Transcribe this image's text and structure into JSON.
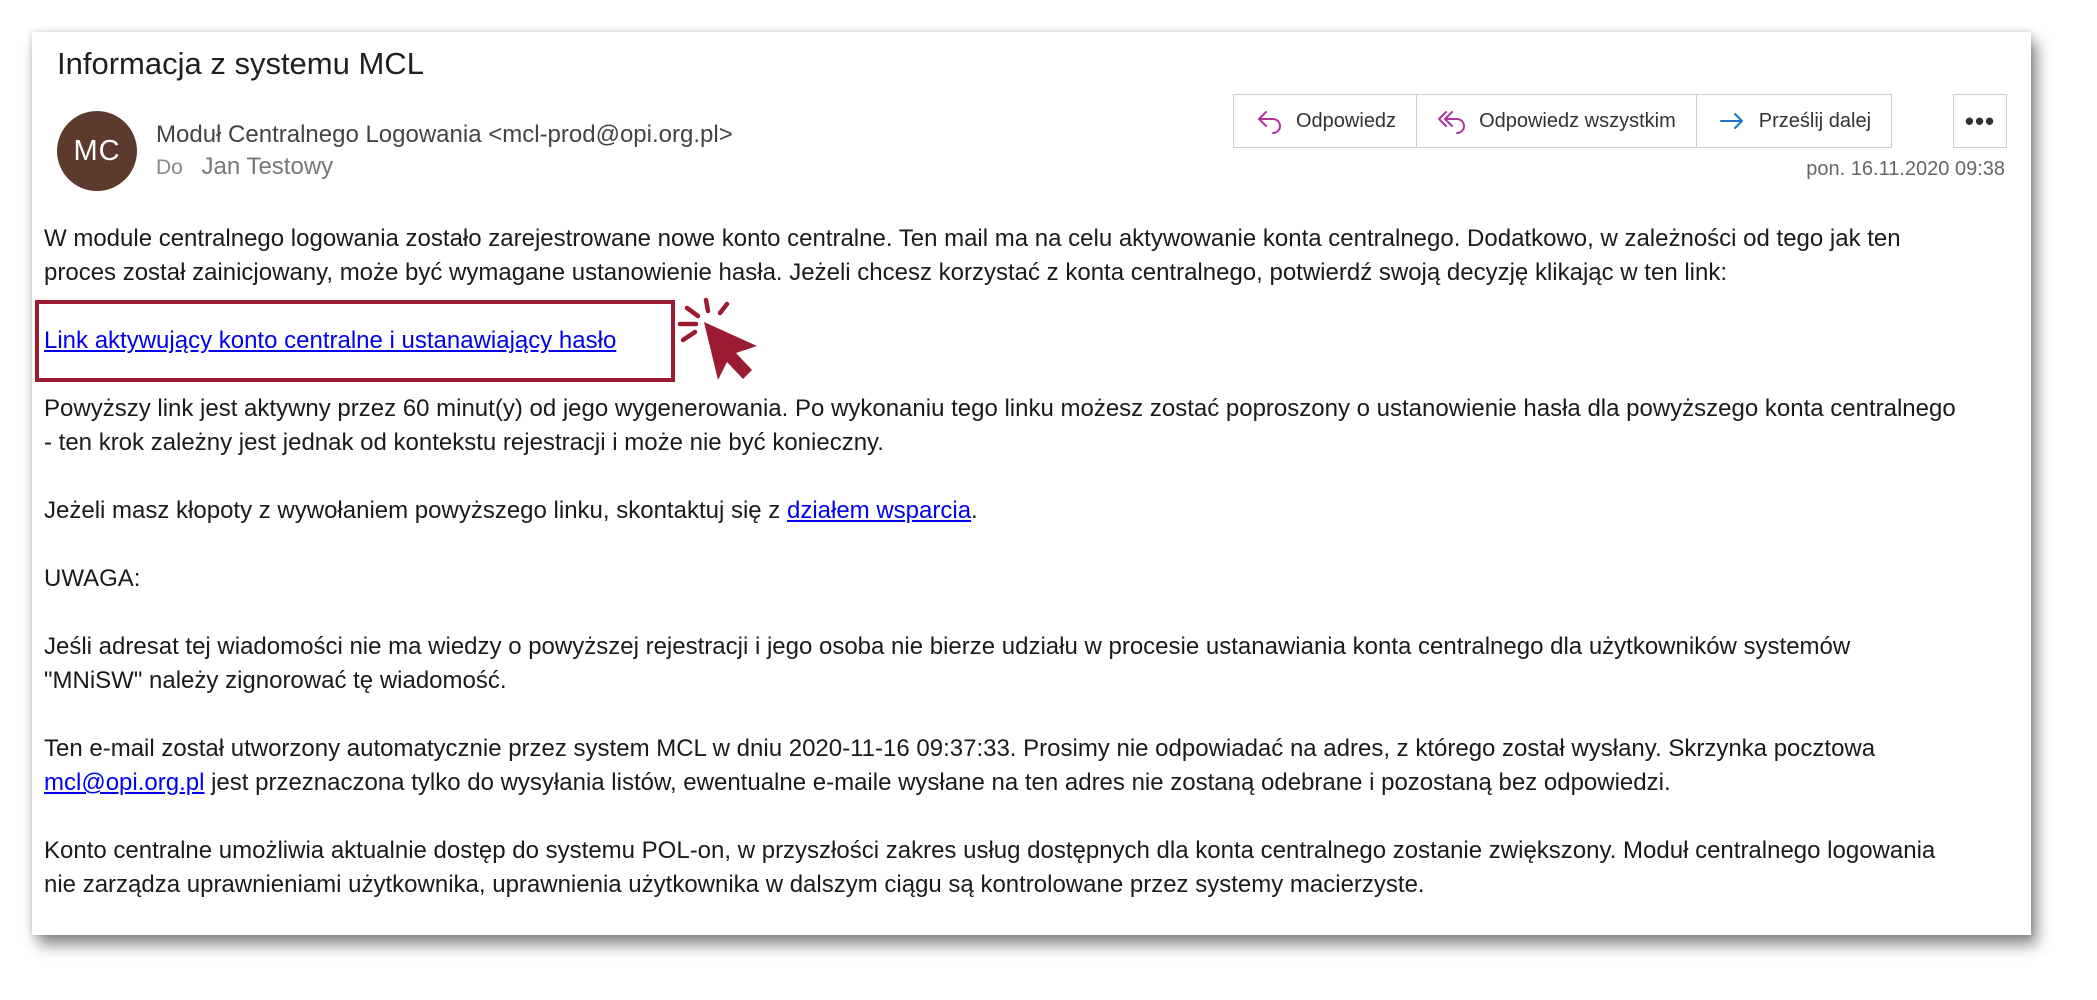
{
  "email": {
    "subject": "Informacja z systemu MCL",
    "avatar_initials": "MC",
    "sender": "Moduł Centralnego Logowania <mcl-prod@opi.org.pl>",
    "to_label": "Do",
    "to_name": "Jan Testowy",
    "date": "pon. 16.11.2020 09:38"
  },
  "actions": {
    "reply": "Odpowiedz",
    "reply_all": "Odpowiedz wszystkim",
    "forward": "Prześlij dalej",
    "more": "•••"
  },
  "colors": {
    "avatar": "#5c3b2e",
    "highlight": "#9b1b30",
    "reply_icon": "#b1339e",
    "forward_icon": "#1a73c9",
    "link": "#0000ee"
  },
  "icons": {
    "reply": "reply-arrow-icon",
    "reply_all": "reply-all-arrow-icon",
    "forward": "forward-arrow-icon",
    "more": "more-options-icon",
    "click": "click-cursor-icon"
  },
  "body": {
    "p1_line1": "W module centralnego logowania zostało zarejestrowane nowe konto centralne. Ten mail ma na celu aktywowanie konta centralnego. Dodatkowo, w zależności od tego jak ten",
    "p1_line2": "proces został zainicjowany, może być wymagane ustanowienie hasła. Jeżeli chcesz korzystać z konta centralnego, potwierdź swoją decyzję klikając w ten link:",
    "activation_link": "Link aktywujący konto centralne i ustanawiający hasło",
    "p2_line1": "Powyższy link jest aktywny przez 60 minut(y) od jego wygenerowania. Po wykonaniu tego linku możesz zostać poproszony o ustanowienie hasła dla powyższego konta centralnego",
    "p2_line2": "- ten krok zależny jest jednak od kontekstu rejestracji i może nie być konieczny.",
    "p3_before": "Jeżeli masz kłopoty z wywołaniem powyższego linku, skontaktuj się z ",
    "p3_link": "działem wsparcia",
    "p3_after": ".",
    "warning": "UWAGA:",
    "p4_line1": "Jeśli adresat tej wiadomości nie ma wiedzy o powyższej rejestracji i jego osoba nie bierze udziału w procesie ustanawiania konta centralnego dla użytkowników systemów",
    "p4_line2": "\"MNiSW\" należy zignorować tę wiadomość.",
    "p5_line1": "Ten e-mail został utworzony automatycznie przez system MCL w dniu 2020-11-16 09:37:33. Prosimy nie odpowiadać na adres, z którego został wysłany. Skrzynka pocztowa",
    "p5_link": "mcl@opi.org.pl",
    "p5_line2_after": " jest przeznaczona tylko do wysyłania listów, ewentualne e-maile wysłane na ten adres nie zostaną odebrane i pozostaną bez odpowiedzi.",
    "p6_line1": "Konto centralne umożliwia aktualnie dostęp do systemu POL-on, w przyszłości zakres usług dostępnych dla konta centralnego zostanie zwiększony. Moduł centralnego logowania",
    "p6_line2": "nie zarządza uprawnieniami użytkownika, uprawnienia użytkownika w dalszym ciągu są kontrolowane przez systemy macierzyste."
  }
}
